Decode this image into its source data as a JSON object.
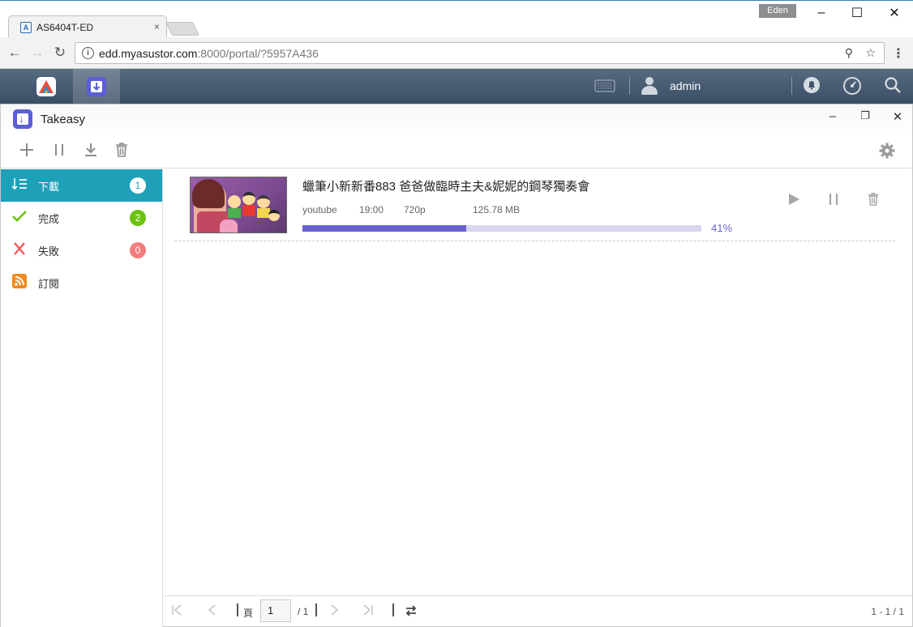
{
  "browser": {
    "tab_title": "AS6404T-ED",
    "tab_close": "×",
    "user_badge": "Eden",
    "url_host": "edd.myasustor.com",
    "url_path": ":8000/portal/?5957A436"
  },
  "nas": {
    "user": "admin"
  },
  "app": {
    "title": "Takeasy"
  },
  "sidebar": {
    "items": [
      {
        "label": "下載",
        "count": "1",
        "badge_color": "#ffffff"
      },
      {
        "label": "完成",
        "count": "2",
        "badge_color": "#6cc20f"
      },
      {
        "label": "失敗",
        "count": "0",
        "badge_color": "#f47c7c"
      },
      {
        "label": "訂閱"
      }
    ]
  },
  "download": {
    "title": "蠟筆小新新番883 爸爸做臨時主夫&妮妮的鋼琴獨奏會",
    "source": "youtube",
    "duration": "19:00",
    "quality": "720p",
    "size": "125.78 MB",
    "progress_percent": 41,
    "progress_label": "41%"
  },
  "pagination": {
    "page_label": "頁",
    "page_value": "1",
    "total_pages": "/ 1",
    "count": "1 - 1 / 1"
  },
  "icons": {
    "add": "plus-icon",
    "pause": "pause-icon",
    "download": "download-icon",
    "delete": "trash-icon",
    "settings": "gear-icon"
  },
  "colors": {
    "accent": "#1ea1b8",
    "progress": "#6a62cf",
    "nas_bar": "#3f5269"
  }
}
